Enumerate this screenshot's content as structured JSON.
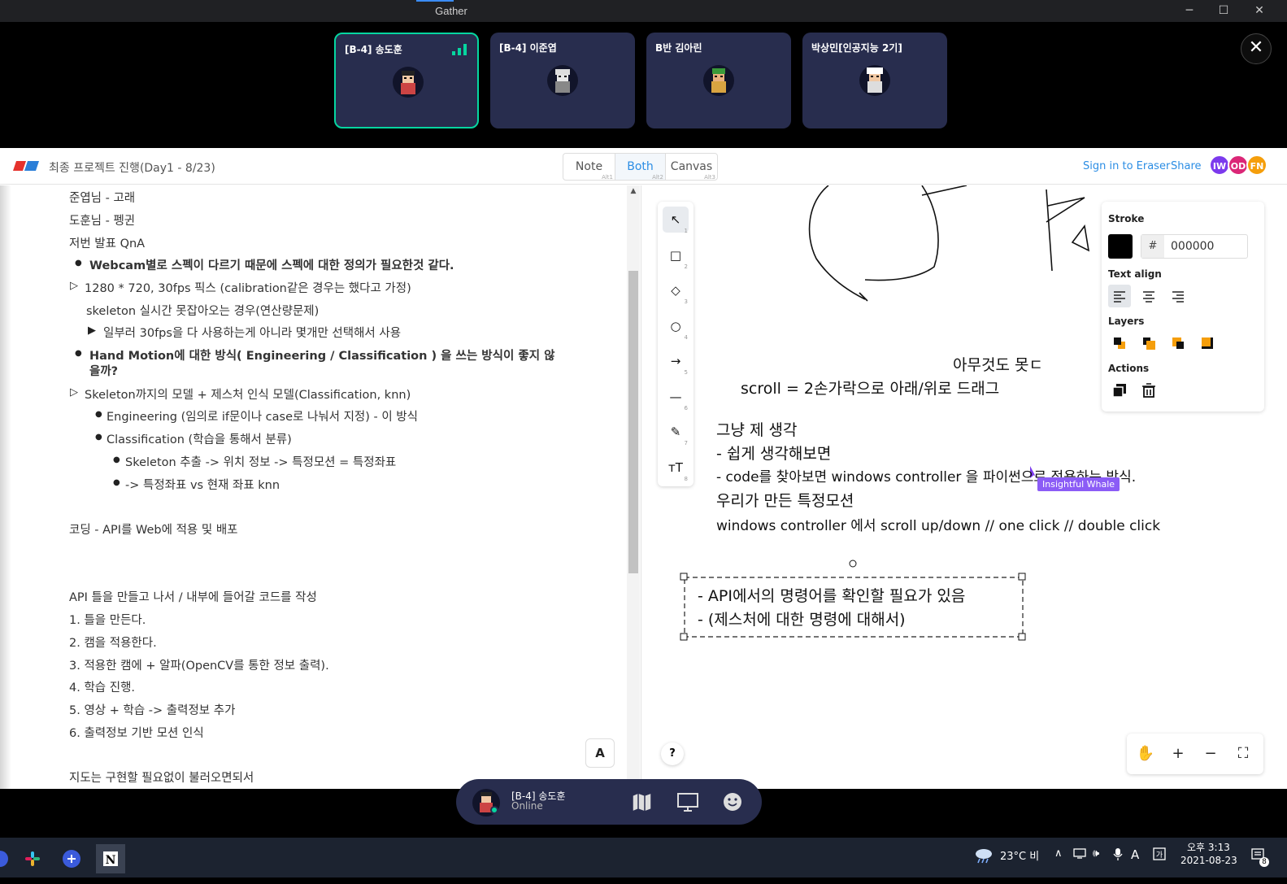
{
  "window": {
    "title": "Gather"
  },
  "participants": [
    {
      "name": "[B-4] 송도훈",
      "active": true
    },
    {
      "name": "[B-4] 이준엽",
      "active": false
    },
    {
      "name": "B반 김아린",
      "active": false
    },
    {
      "name": "박상민[인공지능 2기]",
      "active": false
    }
  ],
  "eraser": {
    "doc_title": "최종 프로젝트 진행(Day1 - 8/23)",
    "modes": [
      {
        "label": "Note",
        "shortcut": "Alt1"
      },
      {
        "label": "Both",
        "shortcut": "Alt2"
      },
      {
        "label": "Canvas",
        "shortcut": "Alt3"
      }
    ],
    "active_mode": "Both",
    "sign_in": "Sign in to Eraser",
    "share": "Share",
    "users": [
      {
        "initials": "IW",
        "color": "#7c3aed"
      },
      {
        "initials": "OD",
        "color": "#db2777"
      },
      {
        "initials": "FN",
        "color": "#f59e0b"
      }
    ]
  },
  "note_lines": {
    "l1": "준엽님 - 고래",
    "l2": "도훈님 - 펭귄",
    "l3": "저번 발표 QnA",
    "l4": "Webcam별로 스펙이 다르기 때문에 스펙에 대한 정의가 필요한것 같다.",
    "l5": "1280 * 720, 30fps 픽스 (calibration같은 경우는 했다고 가정)",
    "l6": "skeleton 실시간 못잡아오는 경우(연산량문제)",
    "l7": "일부러 30fps을 다 사용하는게 아니라 몇개만 선택해서 사용",
    "l8a": "Hand Motion에 대한 방식( Engineering / Classification ) 을 쓰는 방식이 좋지 않",
    "l8b": "을까?",
    "l9": "Skeleton까지의 모델 + 제스처 인식 모델(Classification, knn)",
    "l10": "Engineering (임의로 if문이나 case로 나눠서 지정) - 이 방식",
    "l11": "Classification (학습을 통해서 분류)",
    "l12": "Skeleton 추출 -> 위치 정보 -> 특정모션 = 특정좌표",
    "l13": "-> 특정좌표 vs 현재 좌표 knn",
    "l14": "코딩 - API를 Web에 적용 및 배포",
    "l15": "API 틀을 만들고 나서 / 내부에 들어갈 코드를 작성",
    "l16": "1. 틀을 만든다.",
    "l17": "2. 캠을 적용한다.",
    "l18": "3. 적용한 캠에 + 알파(OpenCV를 통한 정보 출력).",
    "l19": "4. 학습 진행.",
    "l20": "5. 영상 + 학습 -> 출력정보 추가",
    "l21": "6. 출력정보 기반 모션 인식",
    "l22": "지도는 구현할 필요없이 불러오면되서",
    "font_button": "A"
  },
  "canvas": {
    "text1": "아무것도 못ㄷ",
    "text2": "scroll = 2손가락으로 아래/위로 드래그",
    "text3": "그냥 제 생각",
    "text4": "- 쉽게 생각해보면",
    "text5a": "- code를 찾아보면 windows controller 을 ",
    "text5b": "파이썬으로 적용하는 방식.",
    "text6": "우리가 만든 특정모션",
    "text7": "windows controller 에서 scroll up/down // one click // double click",
    "text8": "- API에서의 명령어를 확인할 필요가 있음",
    "text9": "- (제스처에 대한 명령에 대해서)",
    "cursor_label": "Insightful Whale",
    "tools": [
      {
        "icon": "pointer-icon",
        "glyph": "↖",
        "key": "1"
      },
      {
        "icon": "rectangle-icon",
        "glyph": "□",
        "key": "2"
      },
      {
        "icon": "diamond-icon",
        "glyph": "◇",
        "key": "3"
      },
      {
        "icon": "circle-icon",
        "glyph": "○",
        "key": "4"
      },
      {
        "icon": "arrow-icon",
        "glyph": "→",
        "key": "5"
      },
      {
        "icon": "line-icon",
        "glyph": "—",
        "key": "6"
      },
      {
        "icon": "pencil-icon",
        "glyph": "✎",
        "key": "7"
      },
      {
        "icon": "text-icon",
        "glyph": "ᴛT",
        "key": "8"
      }
    ],
    "props": {
      "stroke_label": "Stroke",
      "hash": "#",
      "stroke_hex": "000000",
      "stroke_color": "#000000",
      "text_align_label": "Text align",
      "layers_label": "Layers",
      "actions_label": "Actions",
      "layer_color": "#f59e0b"
    },
    "help": "?",
    "zoom": {
      "hand": "✋",
      "plus": "+",
      "minus": "−",
      "fit": "⛶"
    }
  },
  "gather_bar": {
    "name": "[B-4] 송도훈",
    "status": "Online"
  },
  "taskbar": {
    "weather": "23°C  비",
    "ime": "A",
    "time": "오후 3:13",
    "date": "2021-08-23",
    "notifications": "8"
  }
}
